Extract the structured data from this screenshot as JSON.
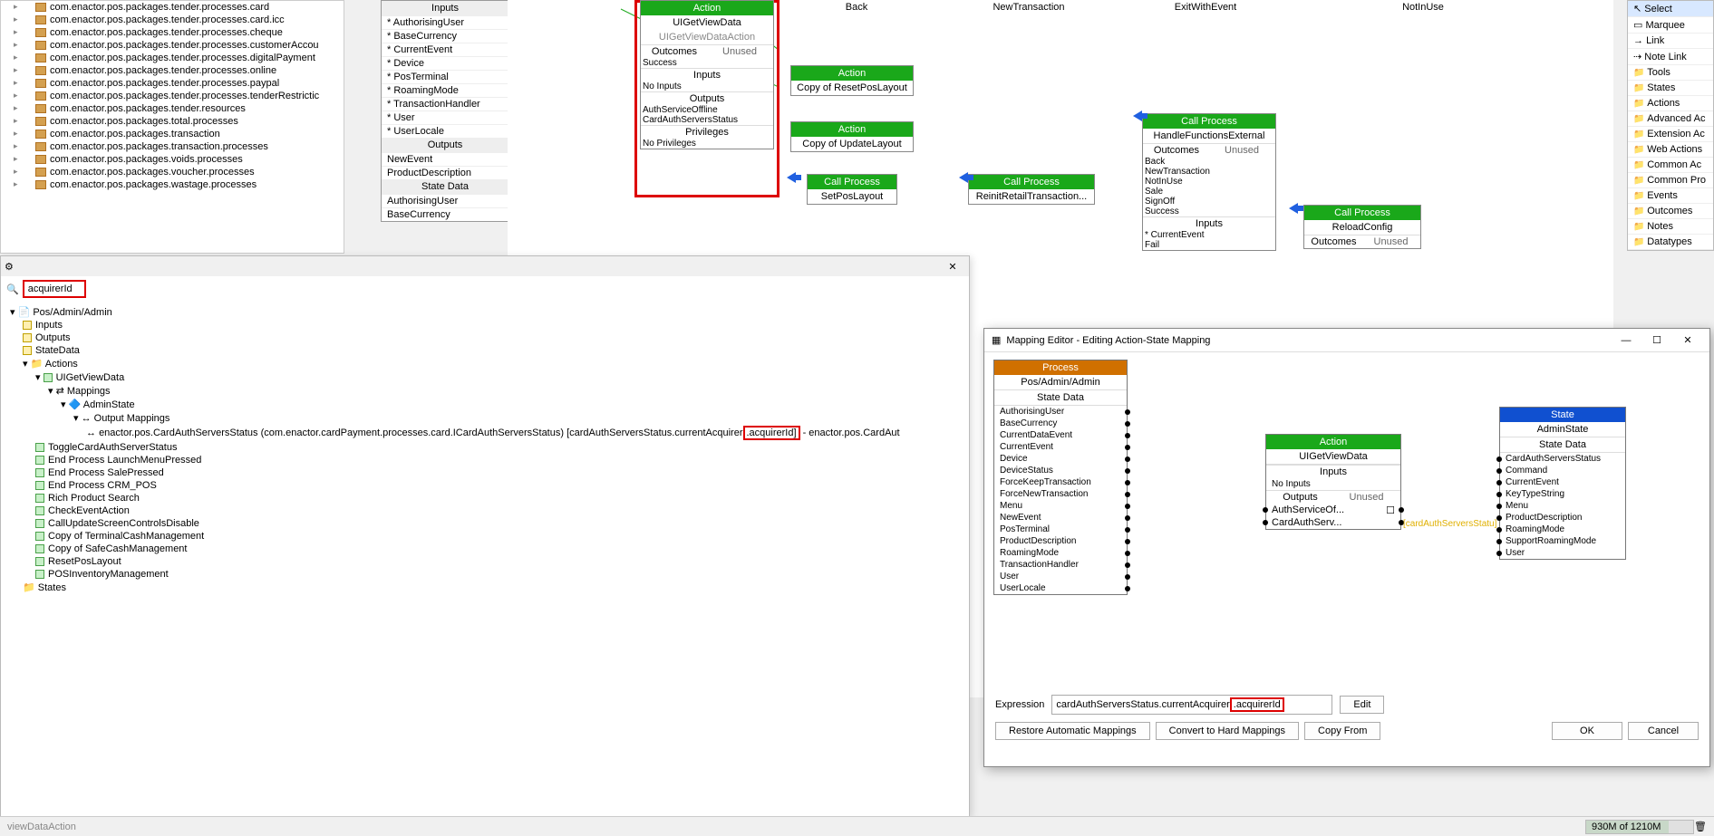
{
  "packages": [
    "com.enactor.pos.packages.tender.processes.card",
    "com.enactor.pos.packages.tender.processes.card.icc",
    "com.enactor.pos.packages.tender.processes.cheque",
    "com.enactor.pos.packages.tender.processes.customerAccou",
    "com.enactor.pos.packages.tender.processes.digitalPayment",
    "com.enactor.pos.packages.tender.processes.online",
    "com.enactor.pos.packages.tender.processes.paypal",
    "com.enactor.pos.packages.tender.processes.tenderRestrictic",
    "com.enactor.pos.packages.tender.resources",
    "com.enactor.pos.packages.total.processes",
    "com.enactor.pos.packages.transaction",
    "com.enactor.pos.packages.transaction.processes",
    "com.enactor.pos.packages.voids.processes",
    "com.enactor.pos.packages.voucher.processes",
    "com.enactor.pos.packages.wastage.processes"
  ],
  "props": {
    "inputs_hdr": "Inputs",
    "inputs": [
      "AuthorisingUser",
      "BaseCurrency",
      "CurrentEvent",
      "Device",
      "PosTerminal",
      "RoamingMode",
      "TransactionHandler",
      "User",
      "UserLocale"
    ],
    "outputs_hdr": "Outputs",
    "outputs": [
      "NewEvent",
      "ProductDescription"
    ],
    "state_hdr": "State Data",
    "state": [
      "AuthorisingUser",
      "BaseCurrency"
    ]
  },
  "action_node": {
    "title": "Action",
    "name": "UIGetViewData",
    "impl": "UIGetViewDataAction",
    "outcomes_hdr": "Outcomes",
    "unused": "Unused",
    "outcomes": [
      "Success"
    ],
    "inputs_hdr": "Inputs",
    "inputs_val": "No Inputs",
    "outputs_hdr": "Outputs",
    "outputs": [
      "AuthServiceOffline",
      "CardAuthServersStatus"
    ],
    "priv_hdr": "Privileges",
    "priv_val": "No Privileges"
  },
  "top_nodes": {
    "back": "Back",
    "newtx": "NewTransaction",
    "exitwith": "ExitWithEvent",
    "notinuse": "NotInUse",
    "action_lbl": "Action",
    "copy_reset": "Copy of ResetPosLayout",
    "copy_update": "Copy of UpdateLayout",
    "callproc": "Call Process",
    "setpos": "SetPosLayout",
    "reinit": "ReinitRetailTransaction...",
    "handle": {
      "title": "Call Process",
      "name": "HandleFunctionsExternal",
      "outcomes_hdr": "Outcomes",
      "unused": "Unused",
      "items": [
        "Back",
        "NewTransaction",
        "NotInUse",
        "Sale",
        "SignOff",
        "Success"
      ],
      "inputs_hdr": "Inputs",
      "inputs": [
        "* CurrentEvent",
        "Fail"
      ]
    },
    "reload": {
      "title": "Call Process",
      "name": "ReloadConfig",
      "outcomes_hdr": "Outcomes",
      "unused": "Unused"
    }
  },
  "search": {
    "value": "acquirerId",
    "root": "Pos/Admin/Admin",
    "inputs": "Inputs",
    "outputs": "Outputs",
    "statedata": "StateData",
    "actions": "Actions",
    "uiget": "UIGetViewData",
    "mappings": "Mappings",
    "adminstate": "AdminState",
    "outmappings": "Output Mappings",
    "mapline_pre": "enactor.pos.CardAuthServersStatus (com.enactor.cardPayment.processes.card.ICardAuthServersStatus) [cardAuthServersStatus.currentAcquirer",
    "mapline_hl": ".acquirerId]",
    "mapline_post": " - enactor.pos.CardAut",
    "actions_list": [
      "ToggleCardAuthServerStatus",
      "End Process LaunchMenuPressed",
      "End Process SalePressed",
      "End Process CRM_POS",
      "Rich Product Search",
      "CheckEventAction",
      "CallUpdateScreenControlsDisable",
      "Copy of TerminalCashManagement",
      "Copy of SafeCashManagement",
      "ResetPosLayout",
      "POSInventoryManagement"
    ],
    "states": "States"
  },
  "palette": {
    "select": "Select",
    "marquee": "Marquee",
    "link": "Link",
    "notelink": "Note Link",
    "folders": [
      "Tools",
      "States",
      "Actions",
      "Advanced Ac",
      "Extension Ac",
      "Web Actions",
      "Common Ac",
      "Common Pro",
      "Events",
      "Outcomes",
      "Notes",
      "Datatypes"
    ]
  },
  "mapping": {
    "title": "Mapping Editor - Editing Action-State Mapping",
    "process": {
      "title": "Process",
      "name": "Pos/Admin/Admin",
      "state_hdr": "State Data",
      "rows": [
        "AuthorisingUser",
        "BaseCurrency",
        "CurrentDataEvent",
        "CurrentEvent",
        "Device",
        "DeviceStatus",
        "ForceKeepTransaction",
        "ForceNewTransaction",
        "Menu",
        "NewEvent",
        "PosTerminal",
        "ProductDescription",
        "RoamingMode",
        "TransactionHandler",
        "User",
        "UserLocale"
      ]
    },
    "action": {
      "title": "Action",
      "name": "UIGetViewData",
      "inputs_hdr": "Inputs",
      "inputs_val": "No Inputs",
      "outputs_hdr": "Outputs",
      "unused": "Unused",
      "outputs": [
        "AuthServiceOf...",
        "CardAuthServ..."
      ]
    },
    "state": {
      "title": "State",
      "name": "AdminState",
      "state_hdr": "State Data",
      "rows": [
        "CardAuthServersStatus",
        "Command",
        "CurrentEvent",
        "KeyTypeString",
        "Menu",
        "ProductDescription",
        "RoamingMode",
        "SupportRoamingMode",
        "User"
      ]
    },
    "yellow": "[cardAuthServersStatu]",
    "expr_lbl": "Expression",
    "expr_pre": "cardAuthServersStatus.currentAcquirer",
    "expr_hl": ".acquirerId",
    "edit": "Edit",
    "restore": "Restore Automatic Mappings",
    "convert": "Convert to Hard Mappings",
    "copyfrom": "Copy From",
    "ok": "OK",
    "cancel": "Cancel"
  },
  "status": {
    "mem": "930M of 1210M",
    "viewdata": "viewDataAction"
  }
}
